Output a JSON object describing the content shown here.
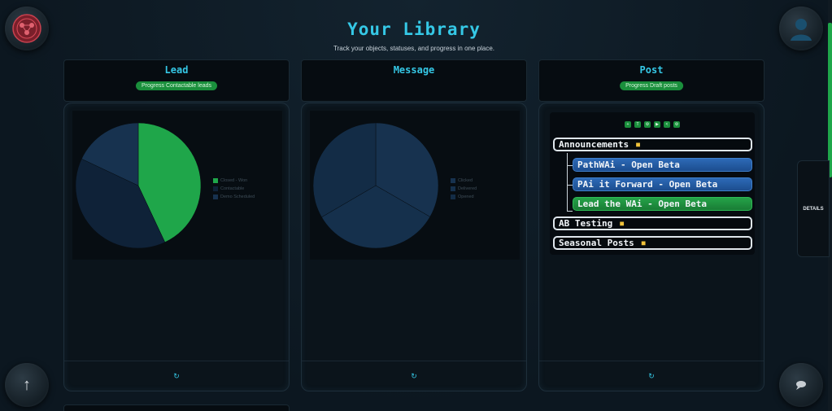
{
  "header": {
    "title": "Your Library",
    "subtitle": "Track your objects, statuses, and progress in one place."
  },
  "side": {
    "details_label": "DETAILS"
  },
  "columns": [
    {
      "title": "Lead",
      "badge": "Progress Contactable leads"
    },
    {
      "title": "Message",
      "badge": ""
    },
    {
      "title": "Post",
      "badge": "Progress Draft posts"
    }
  ],
  "lead_chart": {
    "legend": [
      "Closed - Won",
      "Contactable",
      "Demo Scheduled"
    ]
  },
  "message_chart": {
    "legend": [
      "Clicked",
      "Delivered",
      "Opened"
    ]
  },
  "post_tree": {
    "toolbar": [
      "+",
      "T",
      "⚙",
      "▶",
      "<",
      "⚙"
    ],
    "nodes": [
      "Announcements",
      "PathWAi - Open Beta",
      "PAi it Forward - Open Beta",
      "Lead the WAi - Open Beta",
      "AB Testing",
      "Seasonal Posts"
    ]
  },
  "footer": {
    "refresh_icon": "↻"
  },
  "bottom_panel": {
    "title": ""
  },
  "colors": {
    "accent": "#35c8e6",
    "green": "#1fa64a",
    "blue": "#1c4d8f",
    "navy": "#17324f",
    "dark_navy": "#0f2238"
  },
  "chart_data": [
    {
      "type": "pie",
      "categories": [
        "Closed - Won",
        "Contactable",
        "Demo Scheduled"
      ],
      "values": [
        43,
        39,
        18
      ],
      "colors": [
        "#1fa64a",
        "#0f2238",
        "#17324f"
      ]
    },
    {
      "type": "pie",
      "categories": [
        "Clicked",
        "Delivered",
        "Opened"
      ],
      "values": [
        33.3,
        33.3,
        33.4
      ],
      "colors": [
        "#17324f",
        "#15304c",
        "#132c46"
      ]
    }
  ]
}
